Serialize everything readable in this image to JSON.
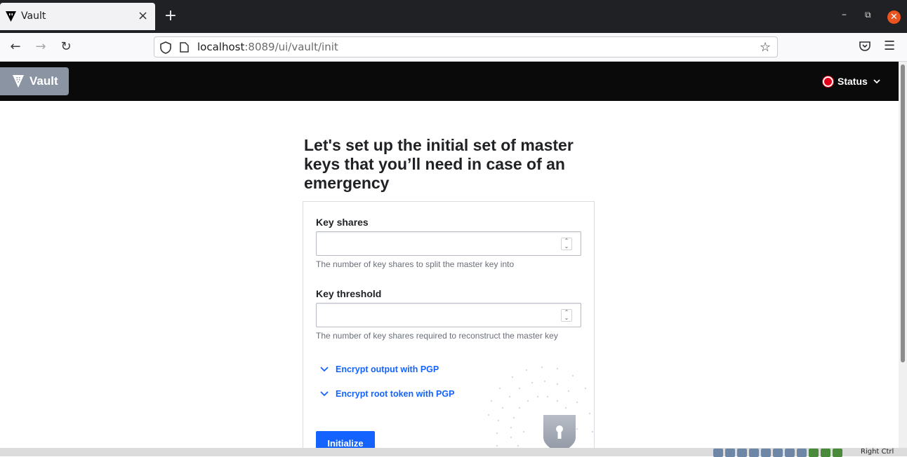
{
  "browser": {
    "tab_title": "Vault",
    "new_tab": "+",
    "url_host": "localhost",
    "url_rest": ":8089/ui/vault/init"
  },
  "header": {
    "logo_text": "Vault",
    "status_label": "Status"
  },
  "main": {
    "title": "Let's set up the initial set of master keys that you’ll need in case of an emergency",
    "key_shares": {
      "label": "Key shares",
      "value": "",
      "help": "The number of key shares to split the master key into"
    },
    "key_threshold": {
      "label": "Key threshold",
      "value": "",
      "help": "The number of key shares required to reconstruct the master key"
    },
    "toggle_pgp_output": "Encrypt output with PGP",
    "toggle_pgp_root": "Encrypt root token with PGP",
    "initialize_button": "Initialize"
  },
  "tray": {
    "label": "Right Ctrl"
  },
  "colors": {
    "accent": "#1563ff",
    "header_bg": "#0a0a0a",
    "status_red": "#e0001a",
    "logo_bg": "#8a94a3"
  }
}
